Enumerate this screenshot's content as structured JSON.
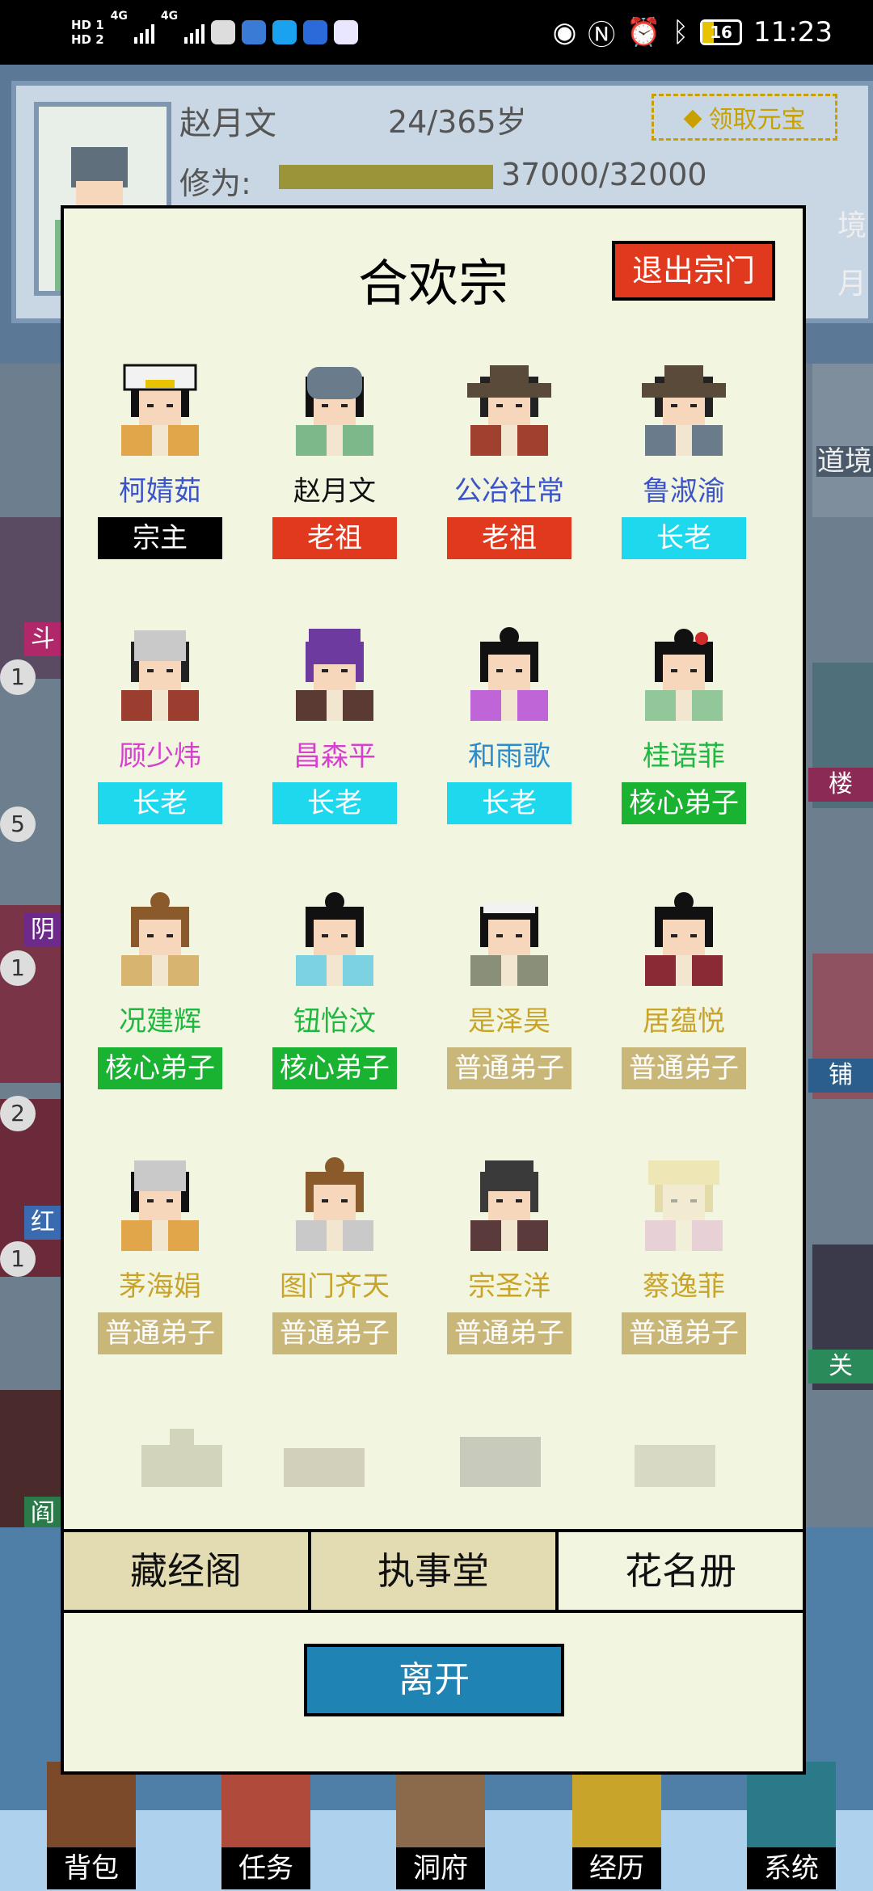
{
  "status_bar": {
    "left": {
      "hd1": "HD 1",
      "hd2": "HD 2",
      "net1": "4G",
      "net2": "4G"
    },
    "icons": [
      "wechat-icon",
      "music-icon",
      "search-icon",
      "bulb-icon",
      "ai-icon"
    ],
    "battery": "16",
    "time": "11:23"
  },
  "background": {
    "player_name": "赵月文",
    "age": "24/365岁",
    "cultivation_label": "修为:",
    "cultivation_value": "37000/32000",
    "claim_button": "领取元宝",
    "right_labels": [
      "境",
      "月"
    ],
    "side_badges": [
      "1",
      "5",
      "1",
      "2",
      "1"
    ],
    "side_tags": [
      "斗",
      "阴",
      "红",
      "阎"
    ],
    "right_tags": [
      "楼",
      "铺",
      "关"
    ],
    "right_top": "道境",
    "dock": [
      "背包",
      "任务",
      "洞府",
      "经历",
      "系统"
    ]
  },
  "modal": {
    "title": "合欢宗",
    "exit_button": "退出宗门",
    "members": [
      {
        "name": "柯婧茹",
        "role": "宗主",
        "name_color": "#3b54c9",
        "role_bg": "#000000",
        "hair": "#111",
        "robe": "#e2a64a",
        "hat": "crown"
      },
      {
        "name": "赵月文",
        "role": "老祖",
        "name_color": "#111111",
        "role_bg": "#e0391e",
        "hair": "#111",
        "robe": "#7cb88a",
        "hat": "cap"
      },
      {
        "name": "公冶社常",
        "role": "老祖",
        "name_color": "#3b54c9",
        "role_bg": "#e0391e",
        "hair": "#222",
        "robe": "#a0402f",
        "hat": "straw"
      },
      {
        "name": "鲁淑渝",
        "role": "长老",
        "name_color": "#3b54c9",
        "role_bg": "#1ed8ee",
        "hair": "#222",
        "robe": "#6a7c8c",
        "hat": "straw"
      },
      {
        "name": "顾少炜",
        "role": "长老",
        "name_color": "#d63fd0",
        "role_bg": "#1ed8ee",
        "hair": "#222",
        "robe": "#9b3d2f",
        "hat": "silver"
      },
      {
        "name": "昌森平",
        "role": "长老",
        "name_color": "#d63fd0",
        "role_bg": "#1ed8ee",
        "hair": "#6d3aa0",
        "robe": "#5a3a32",
        "hat": "purple"
      },
      {
        "name": "和雨歌",
        "role": "长老",
        "name_color": "#2a8ccf",
        "role_bg": "#1ed8ee",
        "hair": "#111",
        "robe": "#c065d8",
        "hat": "bun"
      },
      {
        "name": "桂语菲",
        "role": "核心弟子",
        "name_color": "#1eb73f",
        "role_bg": "#19b331",
        "hair": "#111",
        "robe": "#92c79a",
        "hat": "flower"
      },
      {
        "name": "况建辉",
        "role": "核心弟子",
        "name_color": "#1eb73f",
        "role_bg": "#19b331",
        "hair": "#8a5a2a",
        "robe": "#d7b56f",
        "hat": "bun"
      },
      {
        "name": "钮怡汶",
        "role": "核心弟子",
        "name_color": "#1eb73f",
        "role_bg": "#19b331",
        "hair": "#111",
        "robe": "#7cd2e0",
        "hat": "bun"
      },
      {
        "name": "是泽昊",
        "role": "普通弟子",
        "name_color": "#c9a42a",
        "role_bg": "#c9b77a",
        "hair": "#111",
        "robe": "#8a8f7a",
        "hat": "band"
      },
      {
        "name": "居蕴悦",
        "role": "普通弟子",
        "name_color": "#c9a42a",
        "role_bg": "#c9b77a",
        "hair": "#111",
        "robe": "#8a2a35",
        "hat": "bun"
      },
      {
        "name": "茅海娟",
        "role": "普通弟子",
        "name_color": "#c9a42a",
        "role_bg": "#c9b77a",
        "hair": "#111",
        "robe": "#e2a64a",
        "hat": "silver"
      },
      {
        "name": "图门齐天",
        "role": "普通弟子",
        "name_color": "#c9a42a",
        "role_bg": "#c9b77a",
        "hair": "#8a5a2a",
        "robe": "#c9c9c9",
        "hat": "bun"
      },
      {
        "name": "宗圣洋",
        "role": "普通弟子",
        "name_color": "#c9a42a",
        "role_bg": "#c9b77a",
        "hair": "#3a3a3a",
        "robe": "#5a3a3a",
        "hat": "cap-dark"
      },
      {
        "name": "蔡逸菲",
        "role": "普通弟子",
        "name_color": "#c9a42a",
        "role_bg": "#c9b77a",
        "hair": "#c9b04a",
        "robe": "#d890c8",
        "hat": "crown-faded"
      }
    ],
    "tabs": [
      {
        "label": "藏经阁",
        "active": false
      },
      {
        "label": "执事堂",
        "active": false
      },
      {
        "label": "花名册",
        "active": true
      }
    ],
    "leave_button": "离开"
  }
}
